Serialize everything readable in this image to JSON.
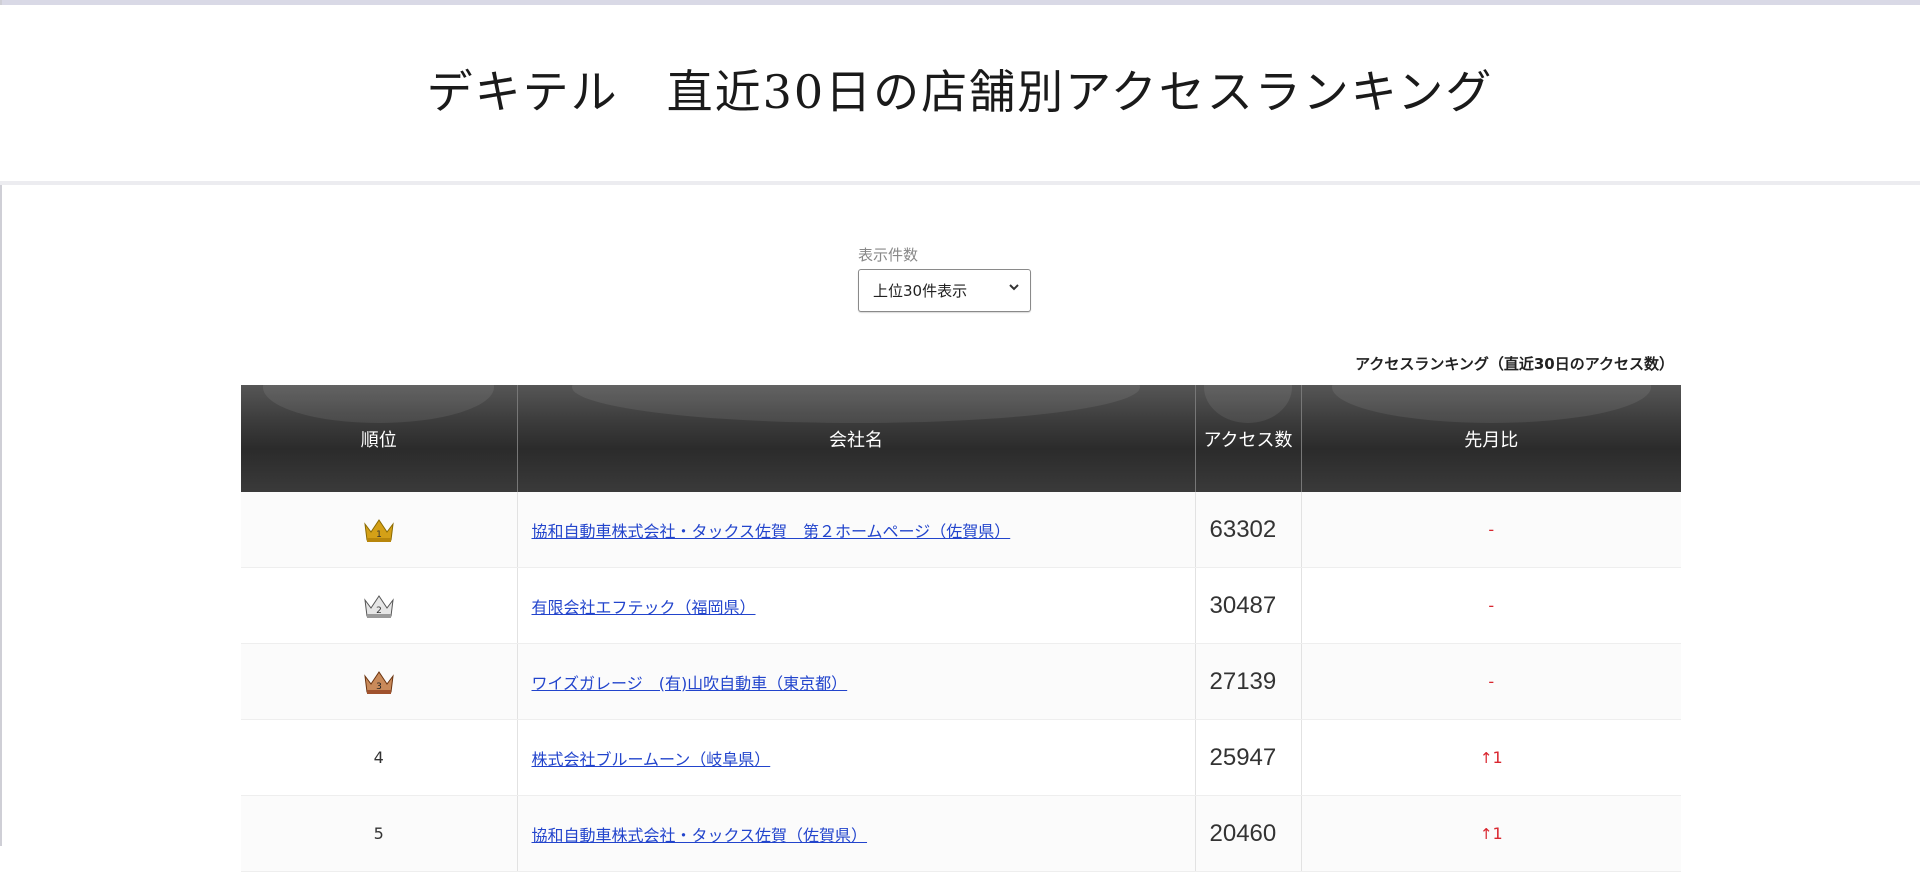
{
  "header": {
    "title": "デキテル　直近30日の店舗別アクセスランキング"
  },
  "display_count": {
    "label": "表示件数",
    "selected": "上位30件表示",
    "chevron_icon": "chevron-down-icon"
  },
  "table": {
    "caption": "アクセスランキング（直近30日のアクセス数）",
    "headers": {
      "rank": "順位",
      "company": "会社名",
      "access": "アクセス数",
      "change": "先月比"
    },
    "rows": [
      {
        "rank": "1",
        "rank_icon": "gold-crown-icon",
        "company": "協和自動車株式会社・タックス佐賀　第２ホームページ（佐賀県）",
        "access": "63302",
        "change": "-"
      },
      {
        "rank": "2",
        "rank_icon": "silver-crown-icon",
        "company": "有限会社エフテック（福岡県）",
        "access": "30487",
        "change": "-"
      },
      {
        "rank": "3",
        "rank_icon": "bronze-crown-icon",
        "company": "ワイズガレージ　(有)山吹自動車（東京都）",
        "access": "27139",
        "change": "-"
      },
      {
        "rank": "4",
        "rank_icon": "",
        "company": "株式会社ブルームーン（岐阜県）",
        "access": "25947",
        "change_arrow": "↑",
        "change": "1"
      },
      {
        "rank": "5",
        "rank_icon": "",
        "company": "協和自動車株式会社・タックス佐賀（佐賀県）",
        "access": "20460",
        "change_arrow": "↑",
        "change": "1"
      }
    ]
  },
  "colors": {
    "header_bg": "#2b2b2b",
    "link": "#2244cc",
    "change_up": "#d9262f",
    "gold": "#d4a017",
    "silver": "#9a9a9a",
    "bronze": "#a0522d"
  }
}
